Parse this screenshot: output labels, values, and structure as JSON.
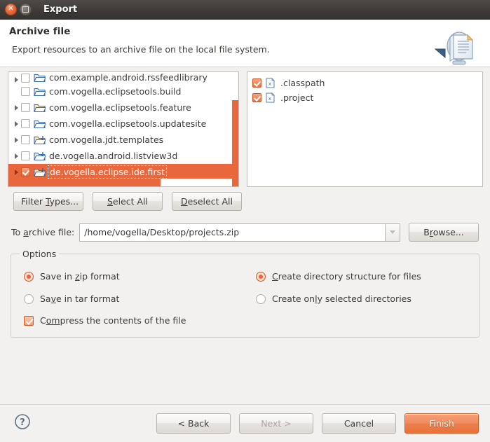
{
  "window": {
    "title": "Export",
    "close_icon": "close-icon",
    "maximize_icon": "maximize-icon"
  },
  "header": {
    "title": "Archive file",
    "description": "Export resources to an archive file on the local file system.",
    "banner_icon": "export-archive-banner-icon"
  },
  "project_tree": {
    "items": [
      {
        "label": "com.example.android.rssfeedlibrary",
        "expandable": true,
        "checked": false,
        "selected": false,
        "icon": "folder-icon",
        "clipped": true
      },
      {
        "label": "com.vogella.eclipsetools.build",
        "expandable": false,
        "checked": false,
        "selected": false,
        "icon": "folder-icon",
        "clipped": false
      },
      {
        "label": "com.vogella.eclipsetools.feature",
        "expandable": true,
        "checked": false,
        "selected": false,
        "icon": "folder-icon",
        "clipped": false
      },
      {
        "label": "com.vogella.eclipsetools.updatesite",
        "expandable": true,
        "checked": false,
        "selected": false,
        "icon": "folder-icon",
        "clipped": false
      },
      {
        "label": "com.vogella.jdt.templates",
        "expandable": true,
        "checked": false,
        "selected": false,
        "icon": "java-folder-icon",
        "clipped": false
      },
      {
        "label": "de.vogella.android.listview3d",
        "expandable": true,
        "checked": false,
        "selected": false,
        "icon": "java-folder-icon",
        "clipped": false
      },
      {
        "label": "de.vogella.eclipse.ide.first",
        "expandable": true,
        "checked": true,
        "selected": true,
        "icon": "java-folder-icon",
        "clipped": false
      }
    ]
  },
  "file_list": {
    "items": [
      {
        "label": ".classpath",
        "checked": true,
        "icon": "xml-file-icon"
      },
      {
        "label": ".project",
        "checked": true,
        "icon": "xml-file-icon"
      }
    ]
  },
  "toolbar": {
    "filter_types": {
      "pre": "Filter ",
      "mnemonic": "T",
      "post": "ypes..."
    },
    "select_all": {
      "pre": "",
      "mnemonic": "S",
      "post": "elect All"
    },
    "deselect_all": {
      "pre": "",
      "mnemonic": "D",
      "post": "eselect All"
    }
  },
  "archive": {
    "label": {
      "pre": "To ",
      "mnemonic": "a",
      "post": "rchive file:"
    },
    "value": "/home/vogella/Desktop/projects.zip",
    "placeholder": "",
    "dropdown_icon": "chevron-down-icon",
    "dropdown_enabled": false,
    "browse": {
      "pre": "B",
      "mnemonic": "r",
      "post": "owse..."
    }
  },
  "options": {
    "group_title": "Options",
    "save_zip": {
      "pre": "Save in ",
      "mnemonic": "z",
      "post": "ip format",
      "selected": true
    },
    "save_tar": {
      "pre": "Sa",
      "mnemonic": "v",
      "post": "e in tar format",
      "selected": false
    },
    "compress": {
      "pre": "C",
      "mnemonic": "om",
      "post": "press the contents of the file",
      "checked": true
    },
    "create_dir": {
      "pre": "",
      "mnemonic": "C",
      "post": "reate directory structure for files",
      "selected": true
    },
    "create_sel": {
      "pre": "Create on",
      "mnemonic": "l",
      "post": "y selected directories",
      "selected": false
    }
  },
  "footer": {
    "help_icon": "help-icon",
    "back": {
      "label": "< Back",
      "enabled": true
    },
    "next": {
      "label": "Next >",
      "enabled": false
    },
    "cancel": {
      "label": "Cancel",
      "enabled": true
    },
    "finish": {
      "label": "Finish",
      "enabled": true,
      "accent_color": "#e8713a"
    }
  },
  "colors": {
    "selection": "#e8673c",
    "accent": "#e8713a",
    "titlebar": "#3e3b38",
    "background": "#f2f1f0"
  }
}
